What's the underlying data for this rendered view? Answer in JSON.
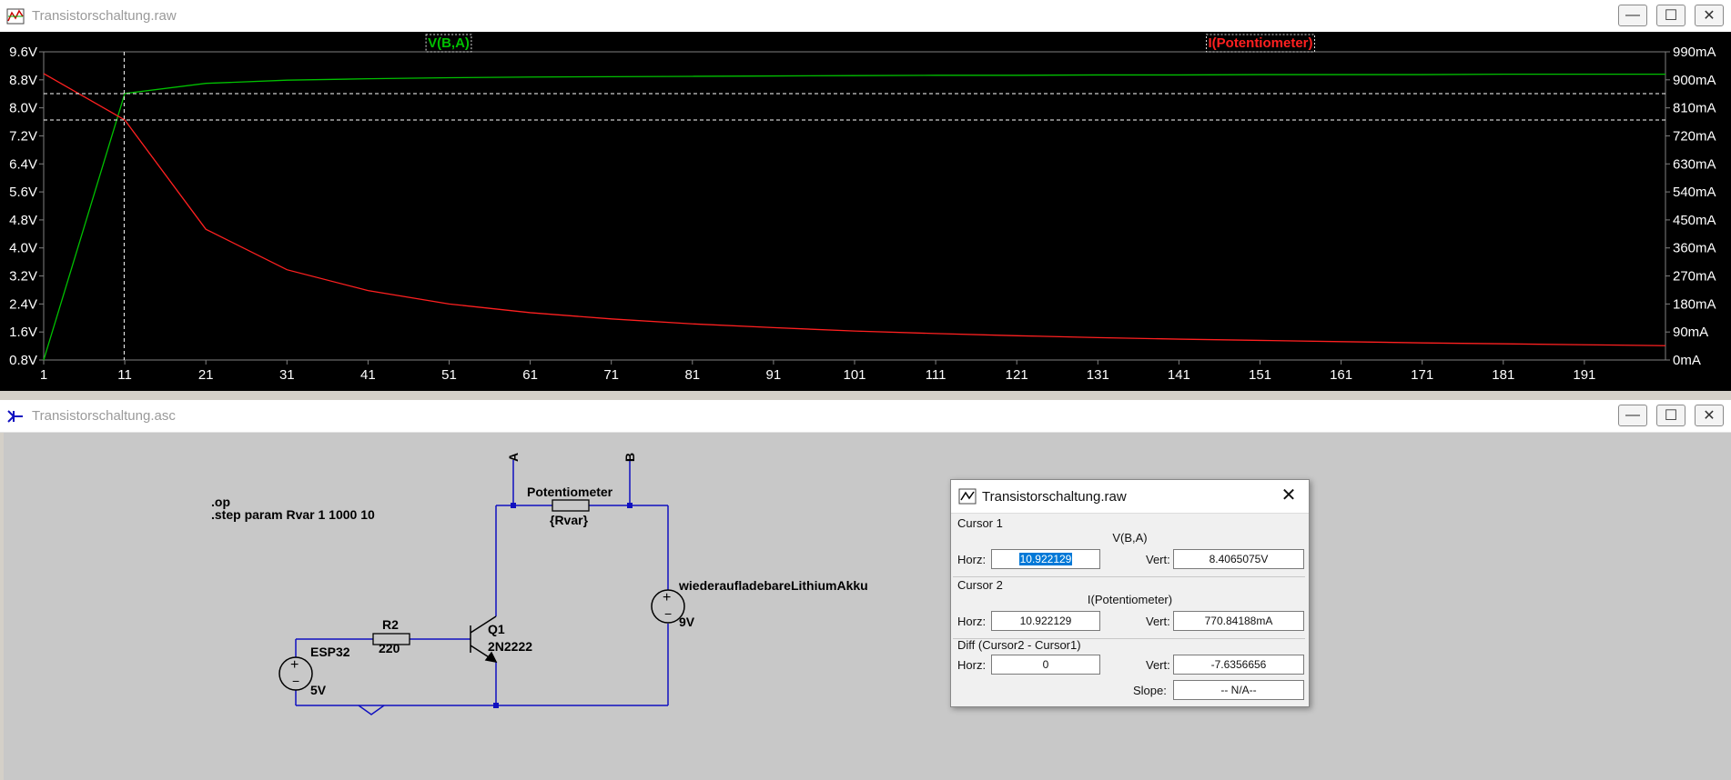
{
  "plot_window": {
    "title": "Transistorschaltung.raw",
    "icon": "waveform-icon",
    "controls": {
      "minimize": "—",
      "maximize": "☐",
      "close": "✕"
    }
  },
  "schematic_window": {
    "title": "Transistorschaltung.asc",
    "icon": "schematic-icon",
    "controls": {
      "minimize": "—",
      "maximize": "☐",
      "close": "✕"
    }
  },
  "colors": {
    "voltage_trace": "#00c000",
    "current_trace": "#ff2020",
    "plot_bg": "#000000",
    "wire": "#1010c0"
  },
  "chart_data": {
    "type": "line",
    "x_ticks": [
      "1",
      "11",
      "21",
      "31",
      "41",
      "51",
      "61",
      "71",
      "81",
      "91",
      "101",
      "111",
      "121",
      "131",
      "141",
      "151",
      "161",
      "171",
      "181",
      "191"
    ],
    "xlim": [
      1,
      201
    ],
    "y_left_ticks": [
      "9.6V",
      "8.8V",
      "8.0V",
      "7.2V",
      "6.4V",
      "5.6V",
      "4.8V",
      "4.0V",
      "3.2V",
      "2.4V",
      "1.6V",
      "0.8V"
    ],
    "y_left_range": [
      0.8,
      9.6
    ],
    "y_right_ticks": [
      "990mA",
      "900mA",
      "810mA",
      "720mA",
      "630mA",
      "540mA",
      "450mA",
      "360mA",
      "270mA",
      "180mA",
      "90mA",
      "0mA"
    ],
    "y_right_range": [
      0,
      990
    ],
    "grid": false,
    "series": [
      {
        "name": "V(B,A)",
        "axis": "left",
        "color": "#00c000",
        "x": [
          1,
          11,
          21,
          31,
          41,
          51,
          61,
          71,
          81,
          91,
          101,
          111,
          121,
          131,
          141,
          151,
          161,
          171,
          181,
          191,
          201
        ],
        "y": [
          0.8,
          8.41,
          8.7,
          8.79,
          8.83,
          8.86,
          8.88,
          8.89,
          8.9,
          8.91,
          8.92,
          8.93,
          8.93,
          8.94,
          8.94,
          8.95,
          8.95,
          8.95,
          8.96,
          8.96,
          8.96
        ]
      },
      {
        "name": "I(Potentiometer)",
        "axis": "right",
        "color": "#ff2020",
        "x": [
          1,
          11,
          21,
          31,
          41,
          51,
          61,
          71,
          81,
          91,
          101,
          111,
          121,
          131,
          141,
          151,
          161,
          171,
          181,
          191,
          201
        ],
        "y": [
          920,
          771,
          420,
          290,
          223,
          180,
          152,
          132,
          116,
          104,
          93,
          85,
          78,
          72,
          67,
          63,
          59,
          55,
          52,
          49,
          46
        ]
      }
    ],
    "cursor": {
      "x": 10.922129,
      "v_left": 8.4065075,
      "i_right": 770.84188
    }
  },
  "schematic": {
    "directive_op": ".op",
    "directive_step": ".step param Rvar 1 1000 10",
    "label_a": "A",
    "label_b": "B",
    "potentiometer_name": "Potentiometer",
    "potentiometer_value": "{Rvar}",
    "battery_name": "wiederaufladebareLithiumAkku",
    "battery_value": "9V",
    "r2_name": "R2",
    "r2_value": "220",
    "q1_name": "Q1",
    "q1_model": "2N2222",
    "esp_name": "ESP32",
    "esp_value": "5V"
  },
  "cursor_dialog": {
    "title": "Transistorschaltung.raw",
    "icon": "cursor-probe-icon",
    "close": "✕",
    "cursor1": {
      "label": "Cursor 1",
      "trace": "V(B,A)",
      "horz_label": "Horz:",
      "horz": "10.922129",
      "vert_label": "Vert:",
      "vert": "8.4065075V"
    },
    "cursor2": {
      "label": "Cursor 2",
      "trace": "I(Potentiometer)",
      "horz_label": "Horz:",
      "horz": "10.922129",
      "vert_label": "Vert:",
      "vert": "770.84188mA"
    },
    "diff": {
      "label": "Diff (Cursor2 - Cursor1)",
      "horz_label": "Horz:",
      "horz": "0",
      "vert_label": "Vert:",
      "vert": "-7.6356656",
      "slope_label": "Slope:",
      "slope": "-- N/A--"
    }
  }
}
